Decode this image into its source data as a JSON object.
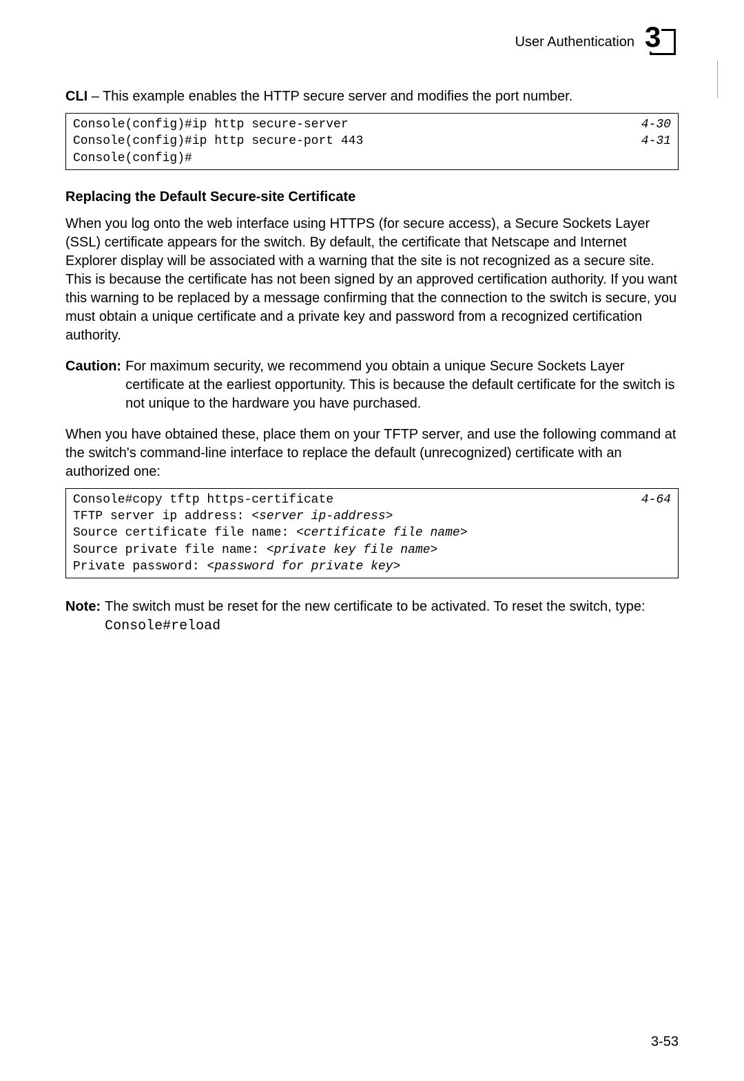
{
  "header": {
    "section": "User Authentication",
    "chapter": "3"
  },
  "intro": {
    "cli_label": "CLI",
    "cli_text": " – This example enables the HTTP secure server and modifies the port number."
  },
  "code1": {
    "line1_left": "Console(config)#ip http secure-server",
    "line1_right": "4-30",
    "line2_left": "Console(config)#ip http secure-port 443",
    "line2_right": "4-31",
    "line3_left": "Console(config)#"
  },
  "subheading": "Replacing the Default Secure-site Certificate",
  "para1": "When you log onto the web interface using HTTPS (for secure access), a Secure Sockets Layer (SSL) certificate appears for the switch. By default, the certificate that Netscape and Internet Explorer display will be associated with a warning that the site is not recognized as a secure site. This is because the certificate has not been signed by an approved certification authority. If you want this warning to be replaced by a message confirming that the connection to the switch is secure, you must obtain a unique certificate and a private key and password from a recognized certification authority.",
  "caution": {
    "label": "Caution:",
    "text": "For maximum security, we recommend you obtain a unique Secure Sockets Layer certificate at the earliest opportunity. This is because the default certificate for the switch is not unique to the hardware you have purchased."
  },
  "para2": "When you have obtained these, place them on your TFTP server, and use the following command at the switch's command-line interface to replace the default (unrecognized) certificate with an authorized one:",
  "code2": {
    "line1_left": "Console#copy tftp https-certificate",
    "line1_right": "4-64",
    "line2_a": "TFTP server ip address: ",
    "line2_b": "<server ip-address>",
    "line3_a": "Source certificate file name: ",
    "line3_b": "<certificate file name>",
    "line4_a": "Source private file name: ",
    "line4_b": "<private key file name>",
    "line5_a": "Private password: ",
    "line5_b": "<password for private key>"
  },
  "note": {
    "label": "Note:",
    "text_a": "The switch must be reset for the new certificate to be activated. To reset the switch, type: ",
    "code": "Console#reload"
  },
  "footer": "3-53"
}
